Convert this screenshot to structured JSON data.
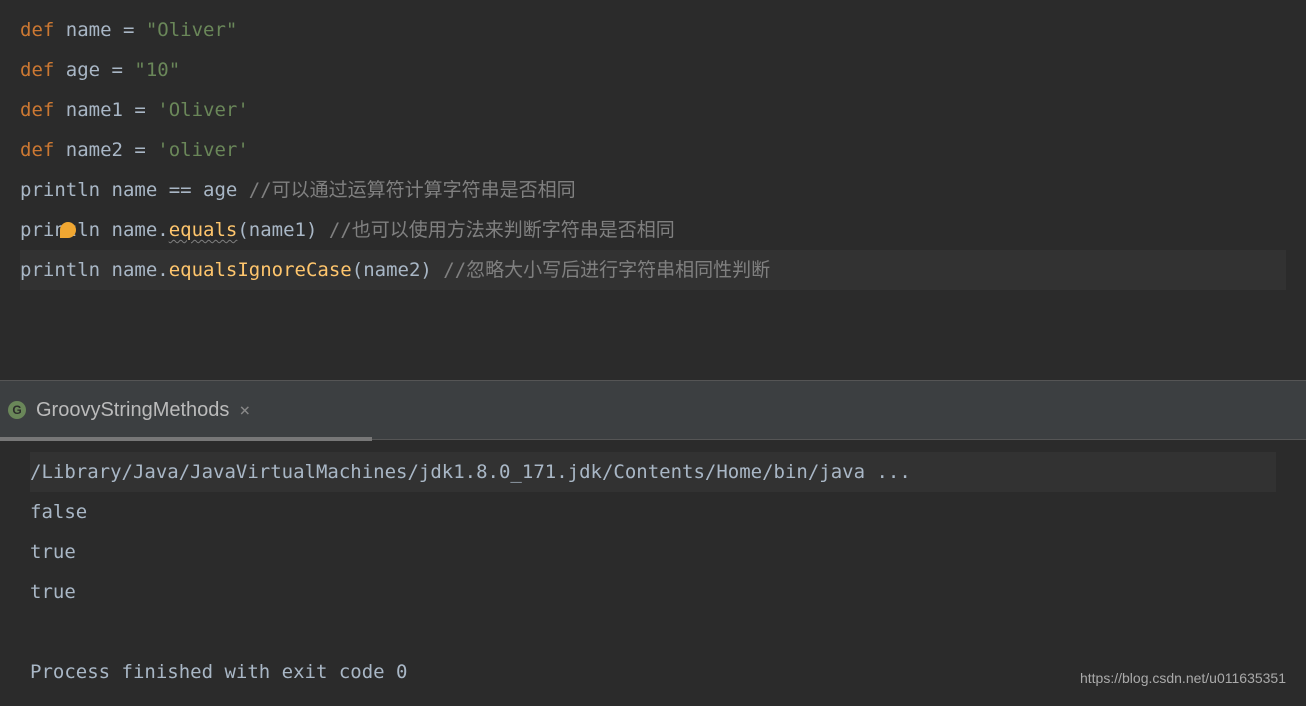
{
  "code": {
    "lines": [
      {
        "tokens": [
          {
            "t": "def ",
            "c": "kw"
          },
          {
            "t": "name ",
            "c": "ident"
          },
          {
            "t": "= ",
            "c": "op"
          },
          {
            "t": "\"Oliver\"",
            "c": "str"
          }
        ]
      },
      {
        "tokens": [
          {
            "t": "def ",
            "c": "kw"
          },
          {
            "t": "age ",
            "c": "ident"
          },
          {
            "t": "= ",
            "c": "op"
          },
          {
            "t": "\"10\"",
            "c": "str"
          }
        ]
      },
      {
        "tokens": [
          {
            "t": "def ",
            "c": "kw"
          },
          {
            "t": "name1 ",
            "c": "ident"
          },
          {
            "t": "= ",
            "c": "op"
          },
          {
            "t": "'Oliver'",
            "c": "str"
          }
        ]
      },
      {
        "tokens": [
          {
            "t": "def ",
            "c": "kw"
          },
          {
            "t": "name2 ",
            "c": "ident"
          },
          {
            "t": "= ",
            "c": "op"
          },
          {
            "t": "'oliver'",
            "c": "str"
          }
        ]
      },
      {
        "tokens": [
          {
            "t": "println name == age ",
            "c": "ident"
          },
          {
            "t": "//可以通过运算符计算字符串是否相同",
            "c": "comment"
          }
        ]
      },
      {
        "bulb": true,
        "tokens": [
          {
            "t": "println name.",
            "c": "ident"
          },
          {
            "t": "equals",
            "c": "method",
            "wavy": true
          },
          {
            "t": "(name1) ",
            "c": "ident"
          },
          {
            "t": "//也可以使用方法来判断字符串是否相同",
            "c": "comment"
          }
        ]
      },
      {
        "highlight": true,
        "tokens": [
          {
            "t": "println name.",
            "c": "ident"
          },
          {
            "t": "equalsIgnoreCase",
            "c": "method"
          },
          {
            "t": "(name2) ",
            "c": "ident"
          },
          {
            "t": "//忽略大小写后进行字符串相同性判断",
            "c": "comment"
          }
        ]
      }
    ]
  },
  "tab": {
    "icon_letter": "G",
    "title": "GroovyStringMethods",
    "close_glyph": "×"
  },
  "console": {
    "cmd": "/Library/Java/JavaVirtualMachines/jdk1.8.0_171.jdk/Contents/Home/bin/java ...",
    "out1": "false",
    "out2": "true",
    "out3": "true",
    "blank": " ",
    "exit": "Process finished with exit code 0"
  },
  "watermark": "https://blog.csdn.net/u011635351"
}
